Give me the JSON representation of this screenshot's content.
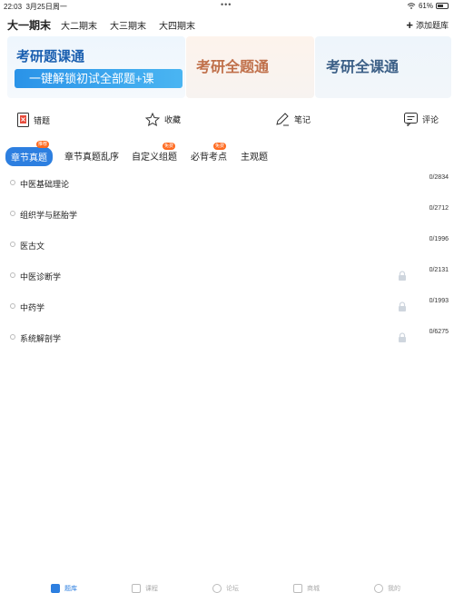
{
  "status_bar": {
    "time": "22:03",
    "date": "3月25日周一",
    "battery_percent": "61%",
    "battery_level": 0.61
  },
  "top_tabs": {
    "items": [
      {
        "label": "大一期末"
      },
      {
        "label": "大二期末"
      },
      {
        "label": "大三期末"
      },
      {
        "label": "大四期末"
      }
    ],
    "active_index": 0,
    "add_label": "添加题库"
  },
  "banners": {
    "b1_title": "考研题课通",
    "b1_cta": "一键解锁初试全部题+课",
    "b2_title": "考研全题通",
    "b3_title": "考研全课通"
  },
  "actions": {
    "wrong": "错题",
    "favorite": "收藏",
    "notes": "笔记",
    "comments": "评论"
  },
  "sub_tabs": {
    "items": [
      {
        "label": "章节真题",
        "badge": "推荐"
      },
      {
        "label": "章节真题乱序",
        "badge": ""
      },
      {
        "label": "自定义组题",
        "badge": "免费"
      },
      {
        "label": "必背考点",
        "badge": "免费"
      },
      {
        "label": "主观题",
        "badge": ""
      }
    ]
  },
  "chapters": [
    {
      "name": "中医基础理论",
      "count": "0/2834",
      "locked": false
    },
    {
      "name": "组织学与胚胎学",
      "count": "0/2712",
      "locked": false
    },
    {
      "name": "医古文",
      "count": "0/1996",
      "locked": false
    },
    {
      "name": "中医诊断学",
      "count": "0/2131",
      "locked": true
    },
    {
      "name": "中药学",
      "count": "0/1993",
      "locked": true
    },
    {
      "name": "系统解剖学",
      "count": "0/6275",
      "locked": true
    }
  ],
  "bottom_nav": {
    "items": [
      {
        "label": "题库"
      },
      {
        "label": "课程"
      },
      {
        "label": "论坛"
      },
      {
        "label": "商城"
      },
      {
        "label": "我的"
      }
    ]
  },
  "colors": {
    "accent": "#2d7fe0",
    "badge": "#ff6a1f"
  }
}
